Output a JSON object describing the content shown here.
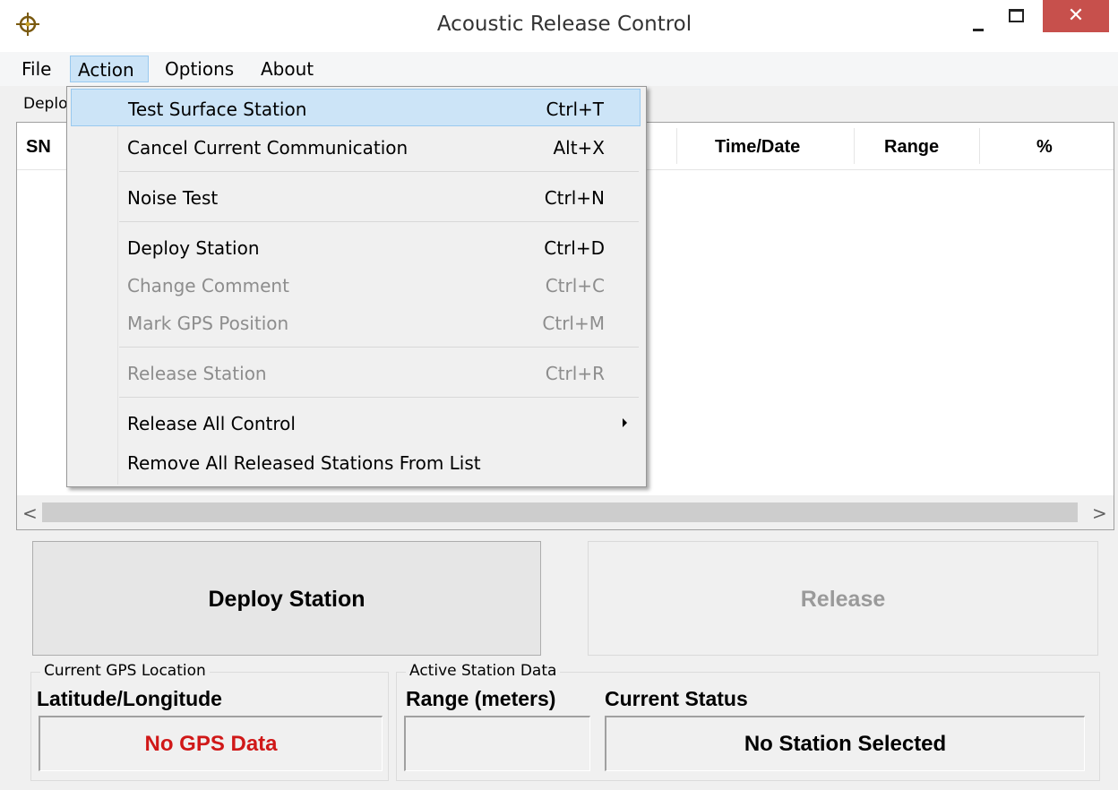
{
  "window": {
    "title": "Acoustic Release Control",
    "close_glyph": "✕"
  },
  "menubar": {
    "items": [
      {
        "label": "File"
      },
      {
        "label": "Action"
      },
      {
        "label": "Options"
      },
      {
        "label": "About"
      }
    ]
  },
  "tab": {
    "label": "Deplo"
  },
  "list": {
    "columns": [
      "SN",
      "Time/Date",
      "Range",
      "%"
    ]
  },
  "scrollbar": {
    "left": "<",
    "right": ">"
  },
  "buttons": {
    "deploy": "Deploy Station",
    "release": "Release"
  },
  "gps_group": {
    "legend": "Current GPS Location",
    "label": "Latitude/Longitude",
    "value": "No GPS Data",
    "value_color": "#d01818"
  },
  "station_group": {
    "legend": "Active Station Data",
    "range_label": "Range (meters)",
    "range_value": "",
    "status_label": "Current Status",
    "status_value": "No Station Selected"
  },
  "action_menu": {
    "items": [
      {
        "label": "Test Surface Station",
        "shortcut": "Ctrl+T",
        "state": "highlighted"
      },
      {
        "label": "Cancel Current Communication",
        "shortcut": "Alt+X",
        "state": "enabled"
      },
      {
        "label": "Noise Test",
        "shortcut": "Ctrl+N",
        "state": "enabled"
      },
      {
        "label": "Deploy Station",
        "shortcut": "Ctrl+D",
        "state": "enabled"
      },
      {
        "label": "Change Comment",
        "shortcut": "Ctrl+C",
        "state": "disabled"
      },
      {
        "label": "Mark GPS Position",
        "shortcut": "Ctrl+M",
        "state": "disabled"
      },
      {
        "label": "Release Station",
        "shortcut": "Ctrl+R",
        "state": "disabled"
      },
      {
        "label": "Release All Control",
        "shortcut": "",
        "state": "submenu"
      },
      {
        "label": "Remove All Released Stations From List",
        "shortcut": "",
        "state": "enabled"
      }
    ]
  },
  "colors": {
    "highlight": "#cce4f7",
    "close_button": "#c7504c",
    "disabled_text": "#8d8d8d"
  },
  "icons": {
    "app": "crosshair-target-icon",
    "minimize": "minimize-icon",
    "maximize": "maximize-icon",
    "close": "close-icon",
    "submenu": "submenu-arrow-icon"
  }
}
